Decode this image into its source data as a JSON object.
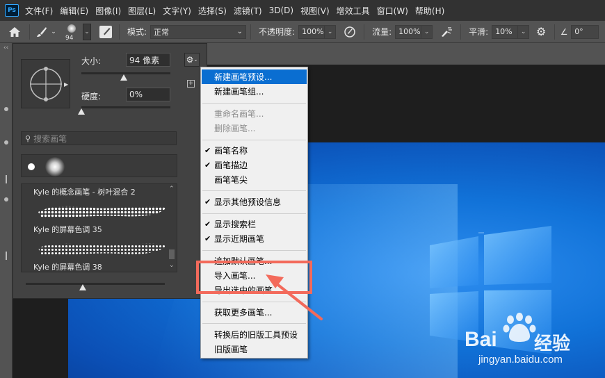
{
  "menubar": {
    "logo": "Ps",
    "items": [
      "文件(F)",
      "编辑(E)",
      "图像(I)",
      "图层(L)",
      "文字(Y)",
      "选择(S)",
      "滤镜(T)",
      "3D(D)",
      "视图(V)",
      "增效工具",
      "窗口(W)",
      "帮助(H)"
    ]
  },
  "options": {
    "brush_size": "94",
    "mode_label": "模式:",
    "mode_value": "正常",
    "opacity_label": "不透明度:",
    "opacity_value": "100%",
    "flow_label": "流量:",
    "flow_value": "100%",
    "smooth_label": "平滑:",
    "smooth_value": "10%",
    "angle_value": "0°"
  },
  "brush_panel": {
    "size_label": "大小:",
    "size_value": "94 像素",
    "hardness_label": "硬度:",
    "hardness_value": "0%",
    "size_fraction": 0.48,
    "hardness_fraction": 0.0,
    "search_placeholder": "搜索画笔",
    "brushes": [
      {
        "label": "Kyle 的概念画笔 - 树叶混合 2"
      },
      {
        "label": "Kyle 的屏幕色调 35"
      },
      {
        "label": "Kyle 的屏幕色调 38"
      }
    ]
  },
  "context_menu": {
    "items": [
      {
        "label": "新建画笔预设...",
        "highlighted": true
      },
      {
        "label": "新建画笔组..."
      },
      {
        "label": "重命名画笔...",
        "disabled": true
      },
      {
        "label": "删除画笔...",
        "disabled": true
      },
      {
        "label": "画笔名称",
        "checked": true
      },
      {
        "label": "画笔描边",
        "checked": true
      },
      {
        "label": "画笔笔尖"
      },
      {
        "label": "显示其他预设信息",
        "checked": true
      },
      {
        "label": "显示搜索栏",
        "checked": true
      },
      {
        "label": "显示近期画笔",
        "checked": true
      },
      {
        "label": "追加默认画笔..."
      },
      {
        "label": "导入画笔..."
      },
      {
        "label": "导出选中的画笔..."
      },
      {
        "label": "获取更多画笔..."
      },
      {
        "label": "转换后的旧版工具预设"
      },
      {
        "label": "旧版画笔"
      }
    ]
  },
  "watermark": {
    "brand_left": "Bai",
    "brand_right": "经验",
    "url": "jingyan.baidu.com"
  },
  "colors": {
    "menu_highlight": "#0a6ed1",
    "annotation": "#f36a5b",
    "wallpaper": "#1172d8"
  }
}
